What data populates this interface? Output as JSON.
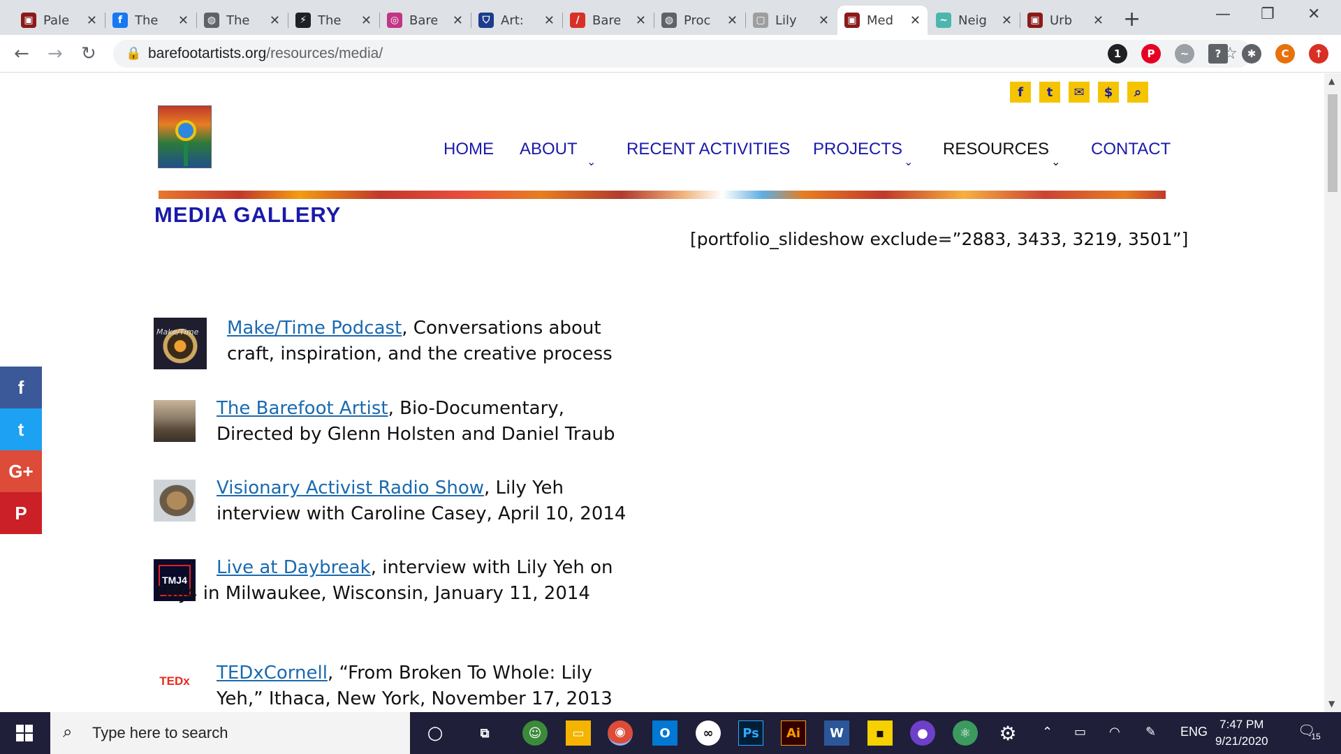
{
  "browser": {
    "tabs": [
      {
        "label": "Pale",
        "favicon": "site-icon",
        "color": "#8b1a1a"
      },
      {
        "label": "The",
        "favicon": "facebook-icon",
        "color": "#1877f2"
      },
      {
        "label": "The",
        "favicon": "globe-icon",
        "color": "#5f6368"
      },
      {
        "label": "The",
        "favicon": "bolt-icon",
        "color": "#202124"
      },
      {
        "label": "Bare",
        "favicon": "instagram-icon",
        "color": "#c13584"
      },
      {
        "label": "Art:",
        "favicon": "shield-icon",
        "color": "#1c3d8c"
      },
      {
        "label": "Bare",
        "favicon": "slash-icon",
        "color": "#d93025"
      },
      {
        "label": "Proc",
        "favicon": "globe-icon",
        "color": "#5f6368"
      },
      {
        "label": "Lily",
        "favicon": "frame-icon",
        "color": "#9e9e9e"
      },
      {
        "label": "Med",
        "favicon": "site-icon",
        "color": "#8b1a1a",
        "active": true
      },
      {
        "label": "Neig",
        "favicon": "bird-icon",
        "color": "#4db6ac"
      },
      {
        "label": "Urb",
        "favicon": "site-icon",
        "color": "#8b1a1a"
      }
    ],
    "url_domain": "barefootartists.org",
    "url_path": "/resources/media/"
  },
  "site": {
    "nav": {
      "home": "HOME",
      "about": "ABOUT",
      "recent": "RECENT ACTIVITIES",
      "projects": "PROJECTS",
      "resources": "RESOURCES",
      "contact": "CONTACT"
    },
    "page_title": "MEDIA GALLERY",
    "shortcode": "[portfolio_slideshow exclude=”2883, 3433, 3219, 3501”]",
    "entries": [
      {
        "link": "Make/Time Podcast",
        "text": ", Conversations about craft, inspiration, and the creative process"
      },
      {
        "link": "The Barefoot Artist",
        "text": ", Bio-Documentary, Directed by Glenn Holsten and Daniel Traub"
      },
      {
        "link": "Visionary Activist Radio Show",
        "text": ", Lily Yeh interview with Caroline Casey, April 10, 2014"
      },
      {
        "link": "Live at Daybreak",
        "text": ", interview with Lily Yeh on TMJ4 in Milwaukee, Wisconsin, January 11, 2014"
      },
      {
        "link": "TEDxCornell",
        "text": ", “From Broken To Whole: Lily Yeh,” Ithaca, New York, November 17, 2013"
      }
    ],
    "thumb_labels": {
      "tmj4": "TMJ4",
      "tedx": "TEDx",
      "maketime": "Make/Time"
    },
    "share": [
      {
        "icon": "facebook-icon",
        "glyph": "f",
        "color": "#3b5998"
      },
      {
        "icon": "twitter-icon",
        "glyph": "✉",
        "color": "#1da1f2"
      },
      {
        "icon": "google-plus-icon",
        "glyph": "G+",
        "color": "#dd4b39"
      },
      {
        "icon": "pinterest-icon",
        "glyph": "P",
        "color": "#cb2027"
      }
    ]
  },
  "taskbar": {
    "search_placeholder": "Type here to search",
    "language": "ENG",
    "time": "7:47 PM",
    "date": "9/21/2020",
    "notifications": "15"
  }
}
